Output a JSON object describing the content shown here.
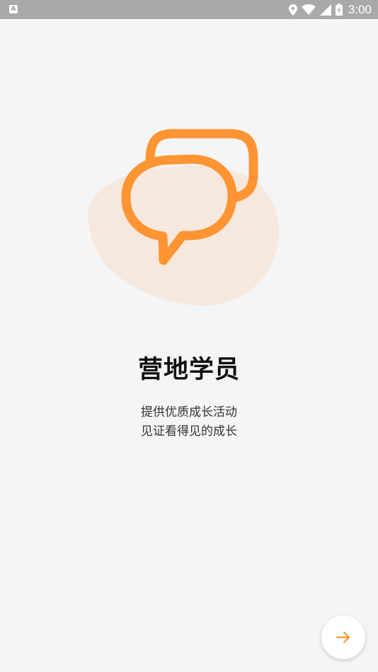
{
  "status_bar": {
    "left_icon_letter": "A",
    "time": "3:00",
    "icons": [
      "location-icon",
      "wifi-icon",
      "signal-icon",
      "battery-charging-icon"
    ]
  },
  "onboarding": {
    "title": "营地学员",
    "description_line1": "提供优质成长活动",
    "description_line2": "见证看得见的成长",
    "illustration_icon": "chat-bubbles-icon",
    "next_icon": "arrow-right-icon"
  },
  "colors": {
    "accent": "#ff9433",
    "blob": "#f6e8dc",
    "background": "#f4f5f7",
    "status_bar": "#a9a9a9"
  }
}
